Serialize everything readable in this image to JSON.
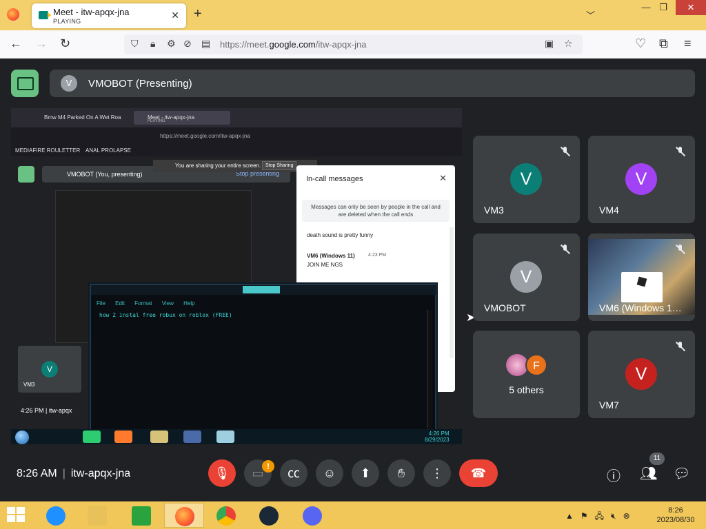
{
  "browser": {
    "tab_title": "Meet - itw-apqx-jna",
    "tab_subtitle": "PLAYING",
    "url_prefix": "https://meet.",
    "url_domain": "google.com",
    "url_path": "/itw-apqx-jna"
  },
  "meet": {
    "banner_initial": "V",
    "banner_text": "VMOBOT (Presenting)",
    "bottom_time": "8:26 AM",
    "bottom_separator": "|",
    "bottom_code": "itw-apqx-jna",
    "camera_badge": "!",
    "people_count": "11"
  },
  "shared_screen": {
    "tab1": "Bmw M4 Parked On A Wet Roa",
    "tab2": "Meet - itw-apqx-jna",
    "tab2_sub": "PLAYING",
    "url": "https://meet.google.com/itw-apqx-jna",
    "bookmark1": "MEDIAFIRE ROULETTER",
    "bookmark2": "ANAL PROLAPSE",
    "banner_text": "VMOBOT (You, presenting)",
    "stop_presenting": "Stop presenting",
    "sharing_text": "You are sharing your entire screen.",
    "stop_sharing": "Stop Sharing",
    "chat": {
      "title": "In-call messages",
      "note": "Messages can only be seen by people in the call and are deleted when the call ends",
      "msg1": "death sound is pretty funny",
      "msg2_name": "VM6 (Windows 11)",
      "msg2_time": "4:23 PM",
      "msg2": "JOIN ME NGS"
    },
    "tile_initial": "V",
    "tile_name": "VM3",
    "bottom_text": "4:26 PM  |  itw-apqx",
    "notepad": {
      "menus": [
        "File",
        "Edit",
        "Format",
        "View",
        "Help"
      ],
      "text": "how 2 instal free robux on roblox (FREE)"
    },
    "clock_time": "4:26 PM",
    "clock_date": "8/29/2023"
  },
  "participants": [
    {
      "initial": "V",
      "name": "VM3",
      "color": "#0b7f75"
    },
    {
      "initial": "V",
      "name": "VM4",
      "color": "#a142f4"
    },
    {
      "initial": "V",
      "name": "VMOBOT",
      "color": "#9aa0a6"
    },
    {
      "initial": "",
      "name": "VM6 (Windows 1…",
      "color": ""
    },
    {
      "initial": "F",
      "name": "5 others",
      "color": "#e8711a"
    },
    {
      "initial": "V",
      "name": "VM7",
      "color": "#c5221f"
    }
  ],
  "taskbar": {
    "clock_time": "8:26",
    "clock_date": "2023/08/30"
  }
}
